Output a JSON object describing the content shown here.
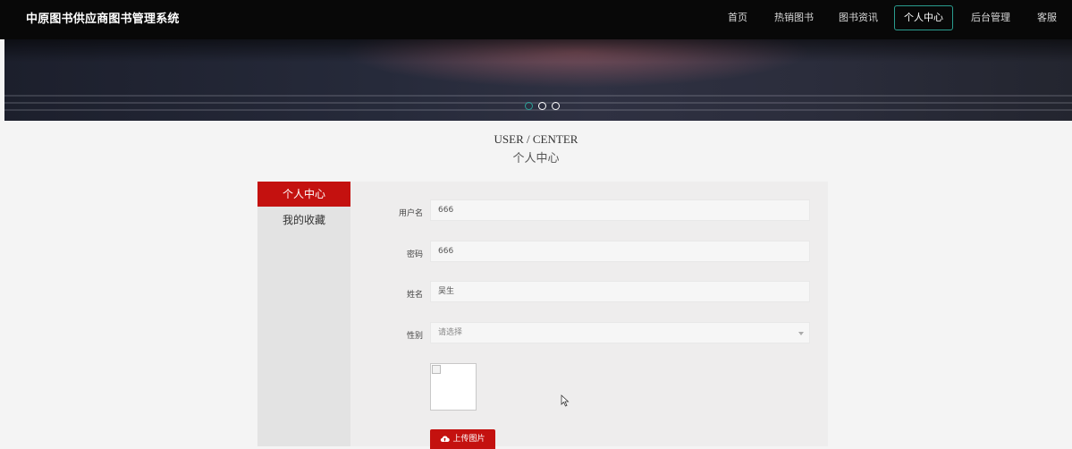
{
  "header": {
    "brand": "中原图书供应商图书管理系统",
    "nav": [
      {
        "label": "首页"
      },
      {
        "label": "热销图书"
      },
      {
        "label": "图书资讯"
      },
      {
        "label": "个人中心",
        "active": true
      },
      {
        "label": "后台管理"
      },
      {
        "label": "客服"
      }
    ]
  },
  "banner": {
    "slides_count": 3,
    "active_slide": 1
  },
  "section": {
    "title_en": "USER / CENTER",
    "title_cn": "个人中心"
  },
  "sidebar": {
    "items": [
      {
        "label": "个人中心",
        "active": true
      },
      {
        "label": "我的收藏"
      }
    ]
  },
  "form": {
    "username": {
      "label": "用户名",
      "value": "666"
    },
    "password": {
      "label": "密码",
      "value": "666"
    },
    "name": {
      "label": "姓名",
      "value": "吴生"
    },
    "gender": {
      "label": "性别",
      "placeholder": "请选择"
    },
    "upload_label": "上传图片"
  },
  "colors": {
    "accent_red": "#c4110f",
    "active_nav_border": "#2a9d8f",
    "topbar_bg": "#080808"
  },
  "icons": {
    "upload": "cloud-upload-icon",
    "select_caret": "chevron-down-icon"
  }
}
